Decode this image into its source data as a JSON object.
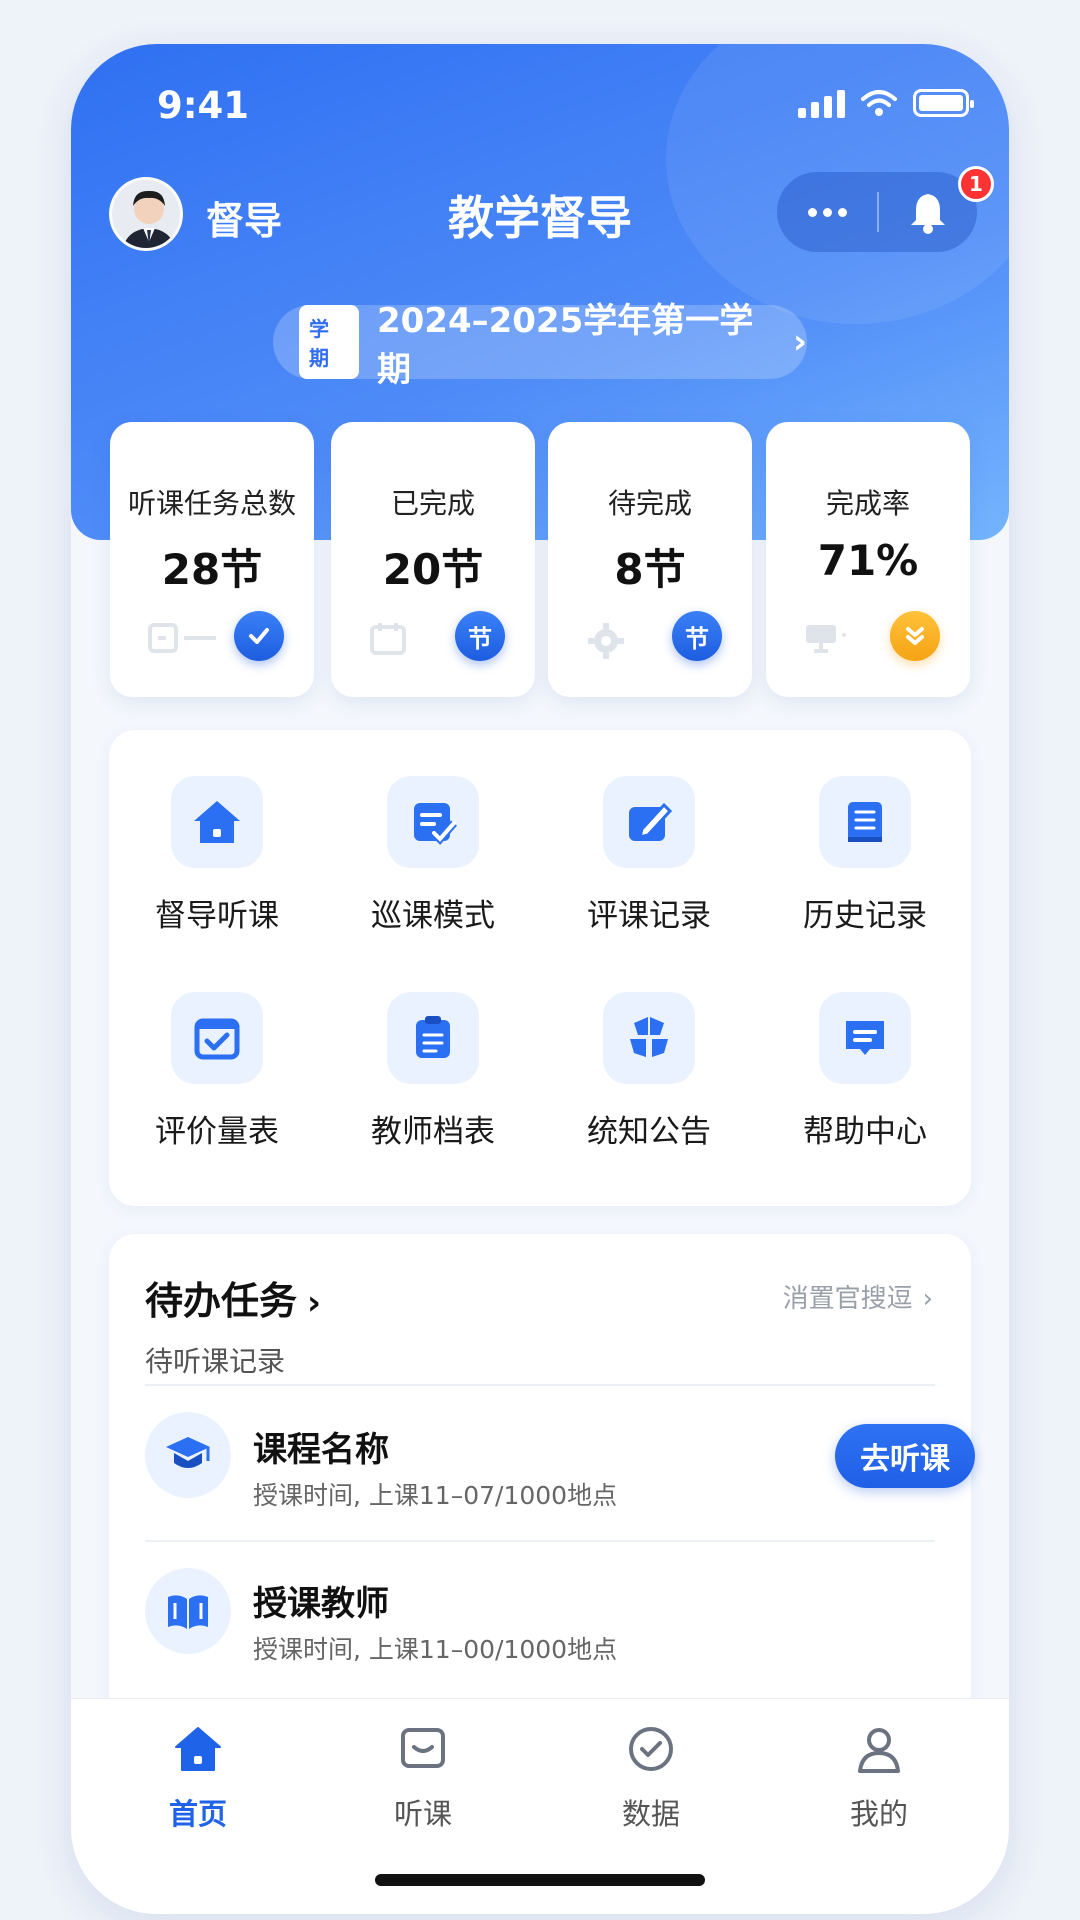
{
  "status_bar": {
    "time": "9:41"
  },
  "header": {
    "role": "督导",
    "title": "教学督导",
    "notification_count": "1"
  },
  "term": {
    "tag": "学期",
    "label": "2024–2025学年第一学期"
  },
  "stats": [
    {
      "label": "听课任务总数",
      "value": "28节",
      "chip": ""
    },
    {
      "label": "已完成",
      "value": "20节",
      "chip": "节"
    },
    {
      "label": "待完成",
      "value": "8节",
      "chip": "节"
    },
    {
      "label": "完成率",
      "value": "71%",
      "chip": ""
    }
  ],
  "features": [
    {
      "label": "督导听课",
      "icon": "house-icon"
    },
    {
      "label": "巡课模式",
      "icon": "check-form-icon"
    },
    {
      "label": "评课记录",
      "icon": "edit-note-icon"
    },
    {
      "label": "历史记录",
      "icon": "book-icon"
    },
    {
      "label": "评价量表",
      "icon": "calendar-check-icon"
    },
    {
      "label": "教师档表",
      "icon": "clipboard-icon"
    },
    {
      "label": "统知公告",
      "icon": "apps-icon"
    },
    {
      "label": "帮助中心",
      "icon": "chat-icon"
    }
  ],
  "tasks": {
    "title": "待办任务",
    "more": "消置官搜逗",
    "subtitle": "待听课记录",
    "items": [
      {
        "name": "课程名称",
        "time": "授课时间, 上课11–07/1000地点",
        "action": "去听课",
        "icon": "graduation-cap-icon"
      },
      {
        "name": "授课教师",
        "time": "授课时间, 上课11–00/1000地点",
        "icon": "open-book-icon"
      }
    ]
  },
  "tabbar": [
    {
      "label": "首页",
      "icon": "home-icon",
      "active": true
    },
    {
      "label": "听课",
      "icon": "message-box-icon"
    },
    {
      "label": "数据",
      "icon": "check-circle-icon"
    },
    {
      "label": "我的",
      "icon": "user-icon"
    }
  ],
  "colors": {
    "primary": "#1f63e8",
    "accent_orange": "#f5a314",
    "badge_red": "#ff3333"
  }
}
